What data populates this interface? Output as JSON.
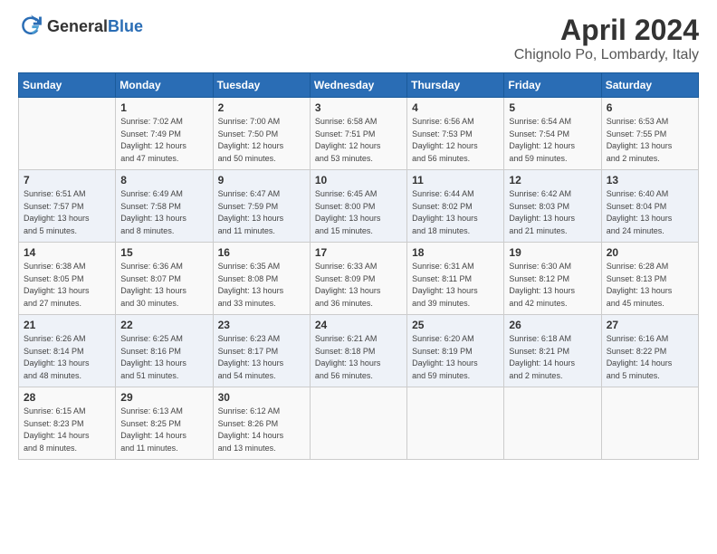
{
  "header": {
    "logo_general": "General",
    "logo_blue": "Blue",
    "title": "April 2024",
    "location": "Chignolo Po, Lombardy, Italy"
  },
  "calendar": {
    "days_of_week": [
      "Sunday",
      "Monday",
      "Tuesday",
      "Wednesday",
      "Thursday",
      "Friday",
      "Saturday"
    ],
    "weeks": [
      [
        {
          "day": "",
          "info": ""
        },
        {
          "day": "1",
          "info": "Sunrise: 7:02 AM\nSunset: 7:49 PM\nDaylight: 12 hours\nand 47 minutes."
        },
        {
          "day": "2",
          "info": "Sunrise: 7:00 AM\nSunset: 7:50 PM\nDaylight: 12 hours\nand 50 minutes."
        },
        {
          "day": "3",
          "info": "Sunrise: 6:58 AM\nSunset: 7:51 PM\nDaylight: 12 hours\nand 53 minutes."
        },
        {
          "day": "4",
          "info": "Sunrise: 6:56 AM\nSunset: 7:53 PM\nDaylight: 12 hours\nand 56 minutes."
        },
        {
          "day": "5",
          "info": "Sunrise: 6:54 AM\nSunset: 7:54 PM\nDaylight: 12 hours\nand 59 minutes."
        },
        {
          "day": "6",
          "info": "Sunrise: 6:53 AM\nSunset: 7:55 PM\nDaylight: 13 hours\nand 2 minutes."
        }
      ],
      [
        {
          "day": "7",
          "info": "Sunrise: 6:51 AM\nSunset: 7:57 PM\nDaylight: 13 hours\nand 5 minutes."
        },
        {
          "day": "8",
          "info": "Sunrise: 6:49 AM\nSunset: 7:58 PM\nDaylight: 13 hours\nand 8 minutes."
        },
        {
          "day": "9",
          "info": "Sunrise: 6:47 AM\nSunset: 7:59 PM\nDaylight: 13 hours\nand 11 minutes."
        },
        {
          "day": "10",
          "info": "Sunrise: 6:45 AM\nSunset: 8:00 PM\nDaylight: 13 hours\nand 15 minutes."
        },
        {
          "day": "11",
          "info": "Sunrise: 6:44 AM\nSunset: 8:02 PM\nDaylight: 13 hours\nand 18 minutes."
        },
        {
          "day": "12",
          "info": "Sunrise: 6:42 AM\nSunset: 8:03 PM\nDaylight: 13 hours\nand 21 minutes."
        },
        {
          "day": "13",
          "info": "Sunrise: 6:40 AM\nSunset: 8:04 PM\nDaylight: 13 hours\nand 24 minutes."
        }
      ],
      [
        {
          "day": "14",
          "info": "Sunrise: 6:38 AM\nSunset: 8:05 PM\nDaylight: 13 hours\nand 27 minutes."
        },
        {
          "day": "15",
          "info": "Sunrise: 6:36 AM\nSunset: 8:07 PM\nDaylight: 13 hours\nand 30 minutes."
        },
        {
          "day": "16",
          "info": "Sunrise: 6:35 AM\nSunset: 8:08 PM\nDaylight: 13 hours\nand 33 minutes."
        },
        {
          "day": "17",
          "info": "Sunrise: 6:33 AM\nSunset: 8:09 PM\nDaylight: 13 hours\nand 36 minutes."
        },
        {
          "day": "18",
          "info": "Sunrise: 6:31 AM\nSunset: 8:11 PM\nDaylight: 13 hours\nand 39 minutes."
        },
        {
          "day": "19",
          "info": "Sunrise: 6:30 AM\nSunset: 8:12 PM\nDaylight: 13 hours\nand 42 minutes."
        },
        {
          "day": "20",
          "info": "Sunrise: 6:28 AM\nSunset: 8:13 PM\nDaylight: 13 hours\nand 45 minutes."
        }
      ],
      [
        {
          "day": "21",
          "info": "Sunrise: 6:26 AM\nSunset: 8:14 PM\nDaylight: 13 hours\nand 48 minutes."
        },
        {
          "day": "22",
          "info": "Sunrise: 6:25 AM\nSunset: 8:16 PM\nDaylight: 13 hours\nand 51 minutes."
        },
        {
          "day": "23",
          "info": "Sunrise: 6:23 AM\nSunset: 8:17 PM\nDaylight: 13 hours\nand 54 minutes."
        },
        {
          "day": "24",
          "info": "Sunrise: 6:21 AM\nSunset: 8:18 PM\nDaylight: 13 hours\nand 56 minutes."
        },
        {
          "day": "25",
          "info": "Sunrise: 6:20 AM\nSunset: 8:19 PM\nDaylight: 13 hours\nand 59 minutes."
        },
        {
          "day": "26",
          "info": "Sunrise: 6:18 AM\nSunset: 8:21 PM\nDaylight: 14 hours\nand 2 minutes."
        },
        {
          "day": "27",
          "info": "Sunrise: 6:16 AM\nSunset: 8:22 PM\nDaylight: 14 hours\nand 5 minutes."
        }
      ],
      [
        {
          "day": "28",
          "info": "Sunrise: 6:15 AM\nSunset: 8:23 PM\nDaylight: 14 hours\nand 8 minutes."
        },
        {
          "day": "29",
          "info": "Sunrise: 6:13 AM\nSunset: 8:25 PM\nDaylight: 14 hours\nand 11 minutes."
        },
        {
          "day": "30",
          "info": "Sunrise: 6:12 AM\nSunset: 8:26 PM\nDaylight: 14 hours\nand 13 minutes."
        },
        {
          "day": "",
          "info": ""
        },
        {
          "day": "",
          "info": ""
        },
        {
          "day": "",
          "info": ""
        },
        {
          "day": "",
          "info": ""
        }
      ]
    ]
  }
}
